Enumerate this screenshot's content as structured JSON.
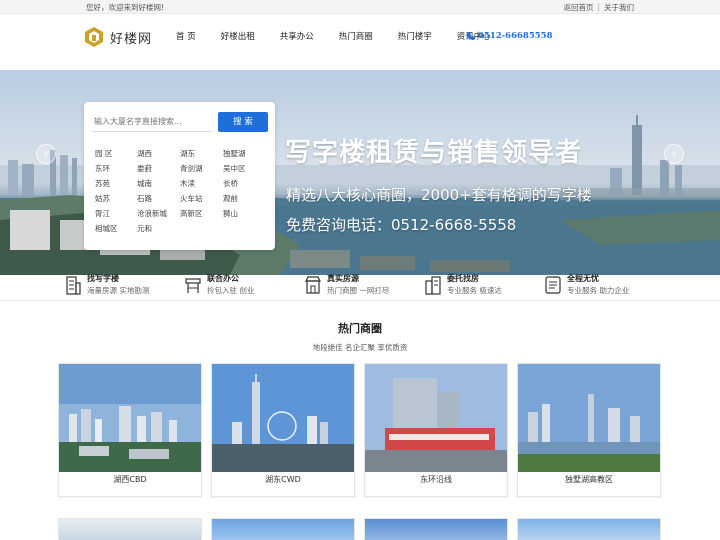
{
  "topbar": {
    "welcome": "您好，欢迎来到好楼网!",
    "home_link": "返回首页",
    "separator": "|",
    "about_link": "关于我们"
  },
  "header": {
    "site_name": "好楼网",
    "nav": [
      "首 页",
      "好楼出租",
      "共享办公",
      "热门商圈",
      "热门楼宇",
      "资讯中心"
    ],
    "phone": "0512-66685558"
  },
  "banner": {
    "headline": "写字楼租赁与销售领导者",
    "subline": "精选八大核心商圈，2000+套有格调的写字楼",
    "hotline": "免费咨询电话：0512-6668-5558",
    "prev_glyph": "‹",
    "next_glyph": "›"
  },
  "search": {
    "placeholder": "输入大厦名字直接搜索...",
    "button": "搜 索",
    "districts": [
      "园 区",
      "湖西",
      "湖东",
      "独墅湖",
      "东环",
      "娄葑",
      "青剑湖",
      "吴中区",
      "苏苑",
      "城南",
      "木渎",
      "长桥",
      "姑苏",
      "石路",
      "火车站",
      "观前",
      "胥江",
      "沧浪新城",
      "高新区",
      "狮山",
      "相城区",
      "元和"
    ]
  },
  "features": [
    {
      "title": "找写字楼",
      "desc": "海量房源 实地勘测",
      "icon": "building-icon"
    },
    {
      "title": "联合办公",
      "desc": "拎包入驻 创业",
      "icon": "desk-icon"
    },
    {
      "title": "真实房源",
      "desc": "热门商圈 一网打尽",
      "icon": "shop-icon"
    },
    {
      "title": "委托找房",
      "desc": "专业服务 极速达",
      "icon": "office-icon"
    },
    {
      "title": "全程无忧",
      "desc": "专业服务 助力企业",
      "icon": "document-icon"
    }
  ],
  "hot": {
    "title": "热门商圈",
    "subtitle": "地段绝佳  名企汇聚  享优质资",
    "cards": [
      "湖西CBD",
      "湖东CWD",
      "东环沿线",
      "独墅湖高教区"
    ]
  },
  "colors": {
    "accent": "#1e6fd9",
    "logo": "#c9a227"
  }
}
